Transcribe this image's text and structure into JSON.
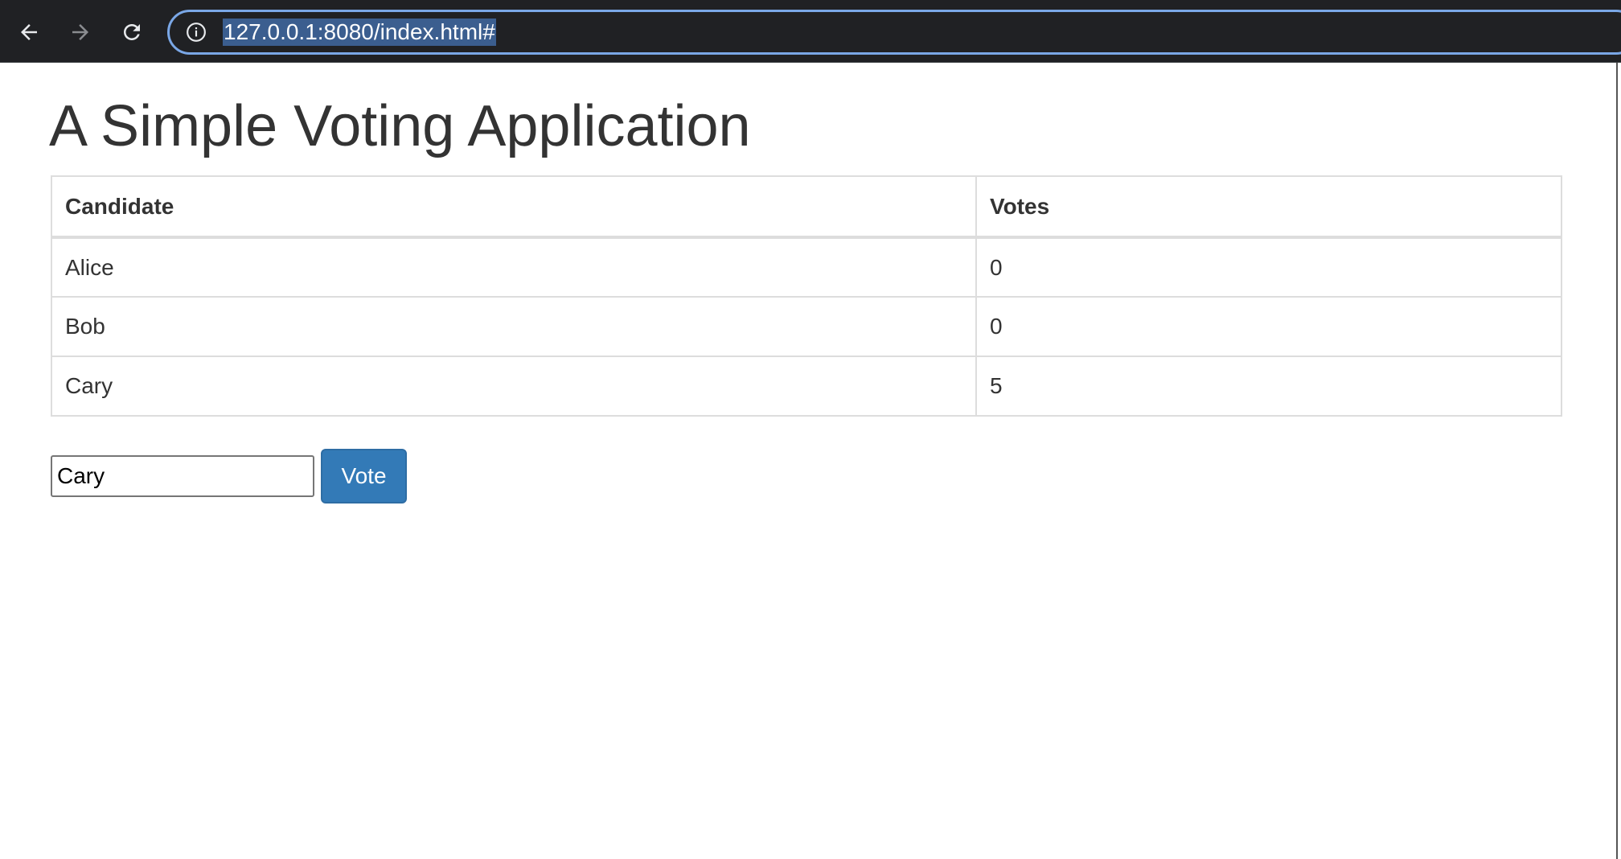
{
  "browser": {
    "url": "127.0.0.1:8080/index.html#",
    "icons": {
      "back": "back-arrow-icon",
      "forward": "forward-arrow-icon",
      "reload": "reload-icon",
      "info": "info-icon"
    }
  },
  "page": {
    "title": "A Simple Voting Application",
    "table": {
      "headers": [
        "Candidate",
        "Votes"
      ],
      "rows": [
        {
          "candidate": "Alice",
          "votes": "0"
        },
        {
          "candidate": "Bob",
          "votes": "0"
        },
        {
          "candidate": "Cary",
          "votes": "5"
        }
      ]
    },
    "form": {
      "input_value": "Cary",
      "vote_button_label": "Vote"
    }
  },
  "colors": {
    "button": "#337ab7",
    "toolbar": "#202124",
    "omnibox_focus_ring": "#7aa7e6",
    "url_selection": "#3b5e8f"
  }
}
